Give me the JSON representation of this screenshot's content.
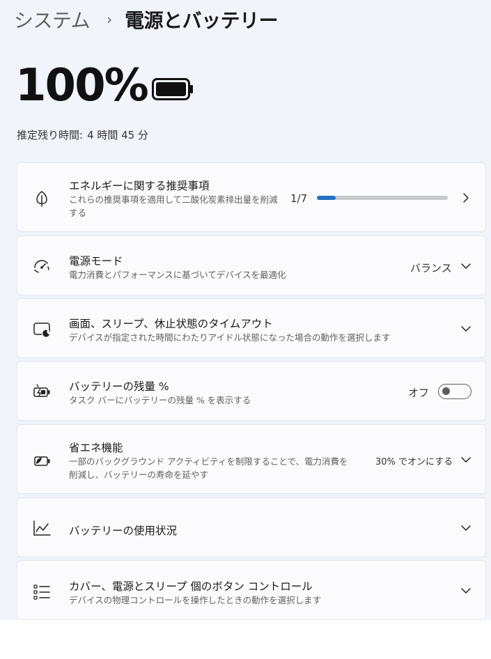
{
  "header": {
    "parent": "システム",
    "separator": "›",
    "current": "電源とバッテリー"
  },
  "battery": {
    "percent_text": "100%",
    "level": 1.0,
    "remaining_label": "推定残り時間:",
    "remaining_value": "4 時間 45 分"
  },
  "cards": {
    "energy": {
      "icon": "leaf-icon",
      "title": "エネルギーに関する推奨事項",
      "desc": "これらの推奨事項を適用して二酸化炭素排出量を削減する",
      "count": "1/7",
      "progress": 0.143,
      "accent": "#1f73c2"
    },
    "power_mode": {
      "icon": "gauge-icon",
      "title": "電源モード",
      "desc": "電力消費とパフォーマンスに基づいてデバイスを最適化",
      "value": "バランス"
    },
    "screen_sleep": {
      "icon": "screen-sleep-icon",
      "title": "画面、スリープ、休止状態のタイムアウト",
      "desc": "デバイスが指定された時間にわたりアイドル状態になった場合の動作を選択します"
    },
    "battery_percent": {
      "icon": "battery-charging-icon",
      "title": "バッテリーの残量 %",
      "desc": "タスク バーにバッテリーの残量 % を表示する",
      "toggle_label": "オフ",
      "toggle_on": false
    },
    "energy_saver": {
      "icon": "energy-saver-icon",
      "title": "省エネ機能",
      "desc": "一部のバックグラウンド アクティビティを制限することで、電力消費を削減し、バッテリーの寿命を延やす",
      "value": "30% でオンにする"
    },
    "battery_usage": {
      "icon": "chart-line-icon",
      "title": "バッテリーの使用状況"
    },
    "buttons": {
      "icon": "list-icon",
      "title": "カバー、電源とスリープ 個のボタン コントロール",
      "desc": "デバイスの物理コントロールを操作したときの動作を選択します"
    }
  }
}
